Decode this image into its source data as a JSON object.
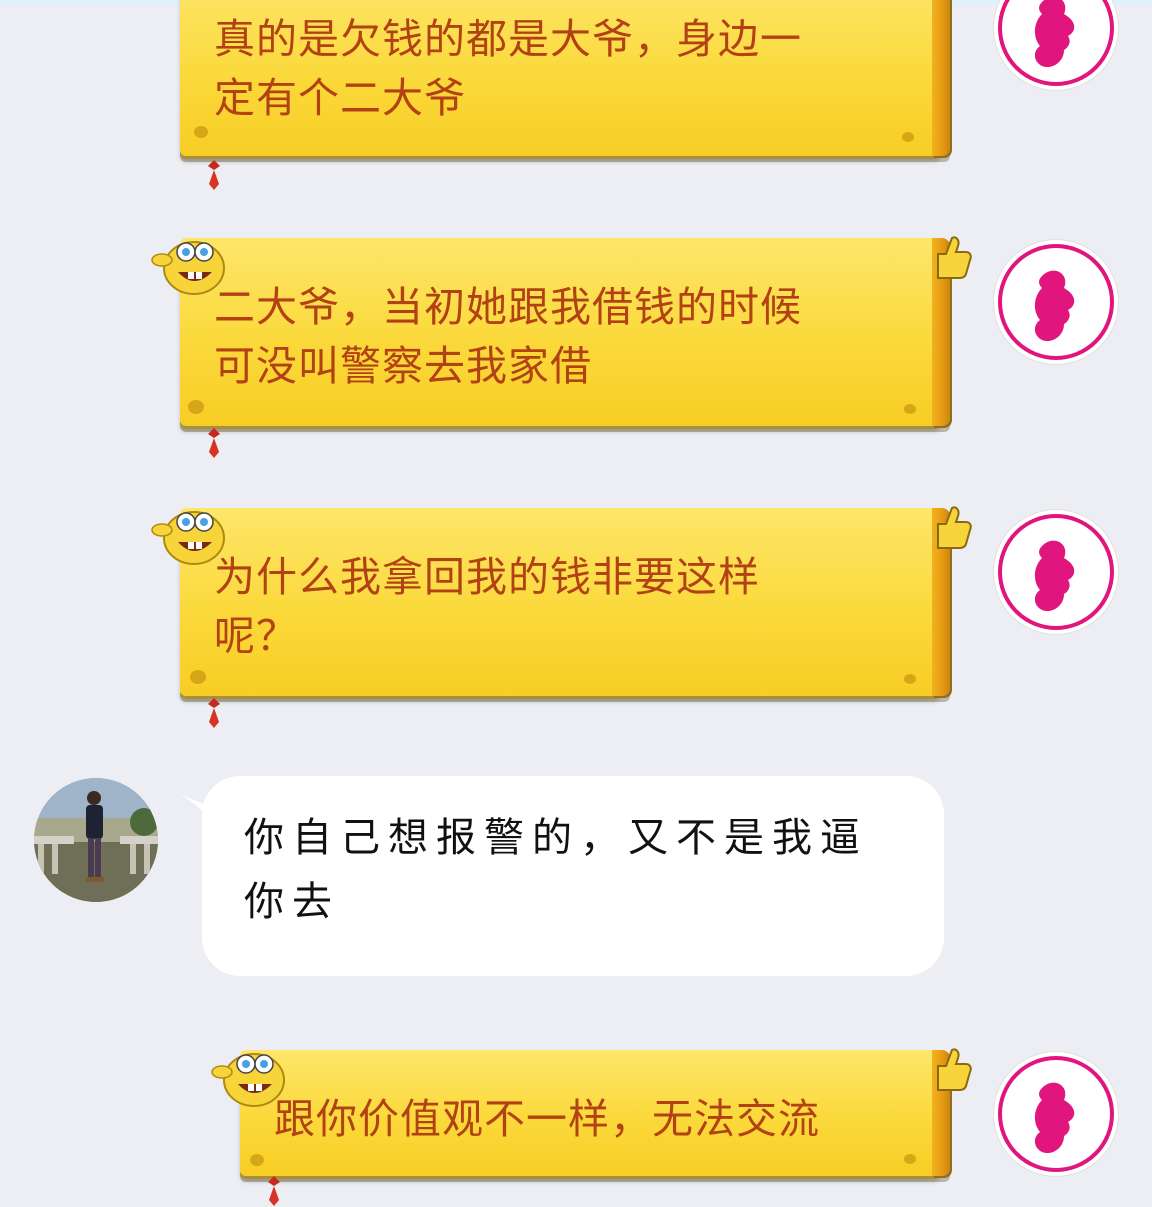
{
  "chat": {
    "messages": [
      {
        "sender": "logo-contact",
        "style": "yellow-scroll",
        "text": "真的是欠钱的都是大爷，身边一\n定有个二大爷"
      },
      {
        "sender": "logo-contact",
        "style": "yellow-scroll",
        "text": "二大爷，当初她跟我借钱的时候\n可没叫警察去我家借"
      },
      {
        "sender": "logo-contact",
        "style": "yellow-scroll",
        "text": "为什么我拿回我的钱非要这样\n呢？"
      },
      {
        "sender": "photo-contact",
        "style": "white",
        "text": "你自己想报警的，又不是我逼\n你去"
      },
      {
        "sender": "logo-contact",
        "style": "yellow-scroll",
        "text": "跟你价值观不一样，无法交流"
      }
    ]
  },
  "colors": {
    "background": "#eceef3",
    "bubble_yellow": "#fbd93b",
    "bubble_text": "#b24214",
    "logo_magenta": "#e0167e",
    "white_bubble": "#ffffff"
  },
  "icons": {
    "contact_avatar": "female-profile-logo-icon",
    "user_avatar": "person-photo-avatar",
    "bubble_decoration": "sponge-character-icon",
    "bubble_thumb": "thumbs-up-icon",
    "bubble_tie": "red-tie-icon"
  }
}
